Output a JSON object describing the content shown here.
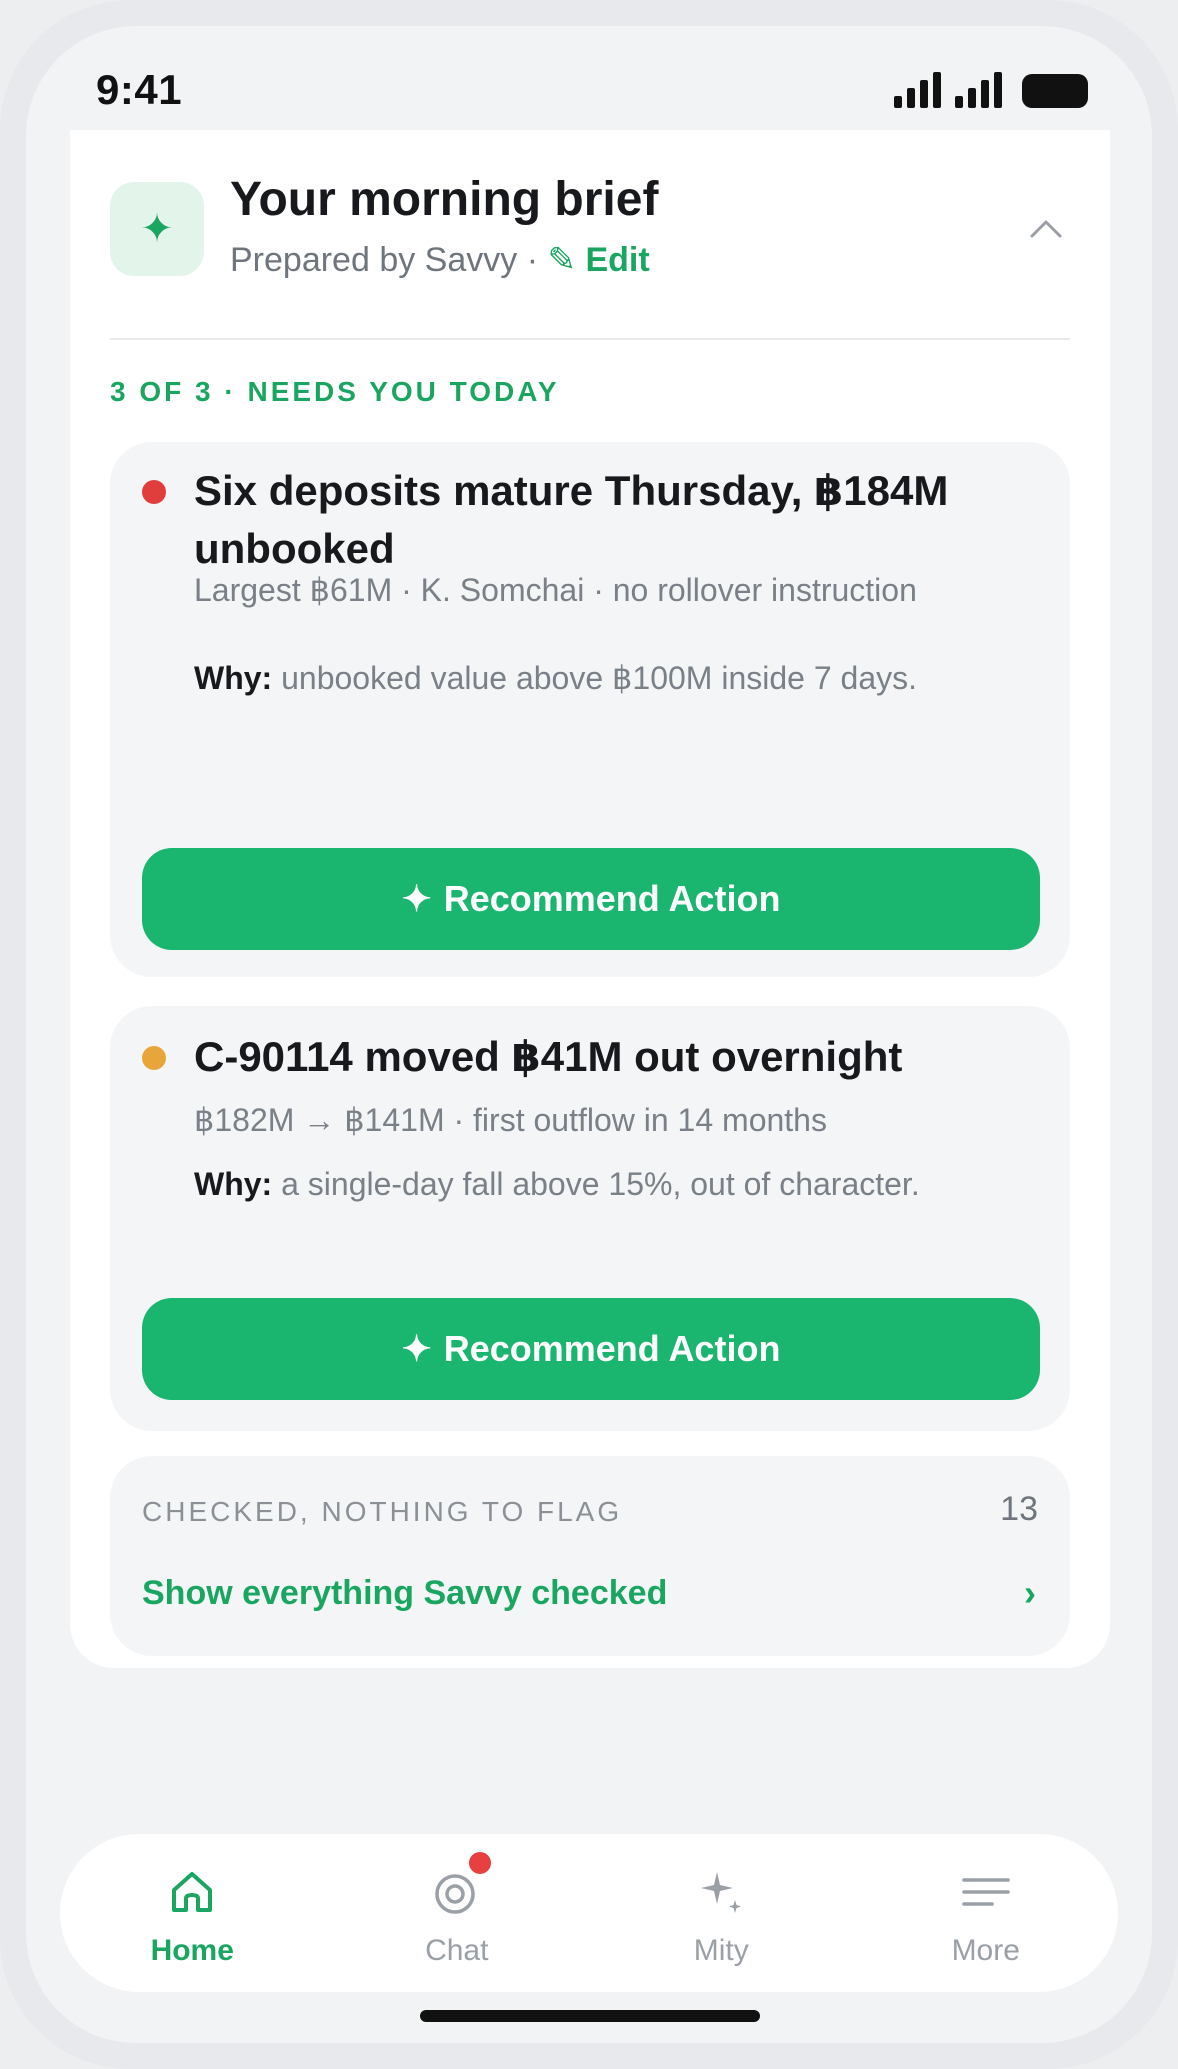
{
  "status_bar": {
    "time": "9:41"
  },
  "brief": {
    "title": "Your morning brief",
    "prepared_by": "Prepared by Savvy · ",
    "edit_label": "Edit",
    "section_label": "3 OF 3 · NEEDS YOU TODAY",
    "items": [
      {
        "dot_color": "#e23d3d",
        "title": "Six deposits mature Thursday, ฿184M unbooked",
        "meta": "Largest ฿61M · K. Somchai · no rollover instruction",
        "why_label": "Why:",
        "why_text": " unbooked value above ฿100M inside 7 days.",
        "cta_label": "Recommend Action"
      },
      {
        "dot_color": "#e8a63a",
        "title": "C-90114 moved ฿41M out overnight",
        "meta": "฿182M → ฿141M · first outflow in 14 months",
        "why_label": "Why:",
        "why_text": " a single-day fall above 15%, out of character.",
        "cta_label": "Recommend Action"
      }
    ],
    "checked": {
      "label": "CHECKED, NOTHING TO FLAG",
      "count": "13",
      "link_label": "Show everything Savvy checked",
      "arrow": "›"
    }
  },
  "nav": {
    "items": [
      {
        "label": "Home",
        "icon": "home-icon",
        "active": true
      },
      {
        "label": "Chat",
        "icon": "chat-icon",
        "active": false
      },
      {
        "label": "Mity",
        "icon": "sparkle-icon",
        "active": false
      },
      {
        "label": "More",
        "icon": "menu-icon",
        "active": false
      }
    ]
  },
  "colors": {
    "accent": "#1aa661",
    "cta": "#1ab66f",
    "badge": "#e84040"
  }
}
